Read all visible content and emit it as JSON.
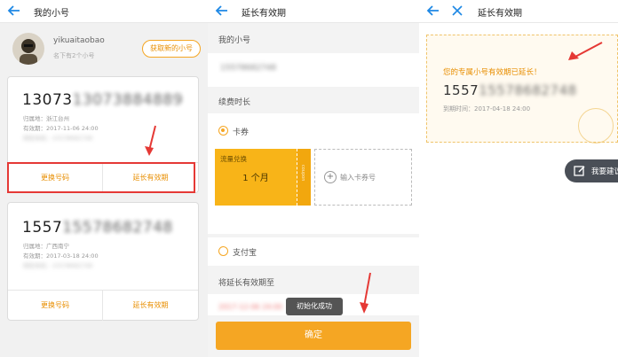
{
  "panel1": {
    "title": "我的小号",
    "profile": {
      "username": "yikuaitaobao",
      "count_text": "名下有2个小号",
      "get_new": "获取新的小号"
    },
    "cards": [
      {
        "number": "13073884889",
        "region": "归属地：浙江台州",
        "expiry": "有效期：2017-11-06 24:00",
        "bound": "绑定本机：15578682748",
        "change": "更换号码",
        "extend": "延长有效期"
      },
      {
        "number": "15578682748",
        "region": "归属地：广西南宁",
        "expiry": "有效期：2017-03-18 24:00",
        "bound": "绑定本机：15578682748",
        "change": "更换号码",
        "extend": "延长有效期"
      }
    ]
  },
  "panel2": {
    "title": "延长有效期",
    "my_number_label": "我的小号",
    "my_number": "15578682748",
    "duration_label": "续费时长",
    "option_card": "卡券",
    "coupon": {
      "title": "流量兑换",
      "duration": "1 个月",
      "stub": "coupon"
    },
    "add_coupon": "输入卡券号",
    "option_alipay": "支付宝",
    "extend_to_label": "将延长有效期至",
    "extend_to_value": "2017-12-06 24:00",
    "toast": "初始化成功",
    "confirm": "确定"
  },
  "panel3": {
    "title": "延长有效期",
    "message": "您的专属小号有效期已延长！",
    "number": "15578682748",
    "expiry": "到期时间：2017-04-18 24:00",
    "suggest": "我要建议"
  },
  "colors": {
    "accent": "#f5a623",
    "accent_dark": "#e88e00",
    "nav": "#1e88e5",
    "highlight": "#e53935"
  }
}
